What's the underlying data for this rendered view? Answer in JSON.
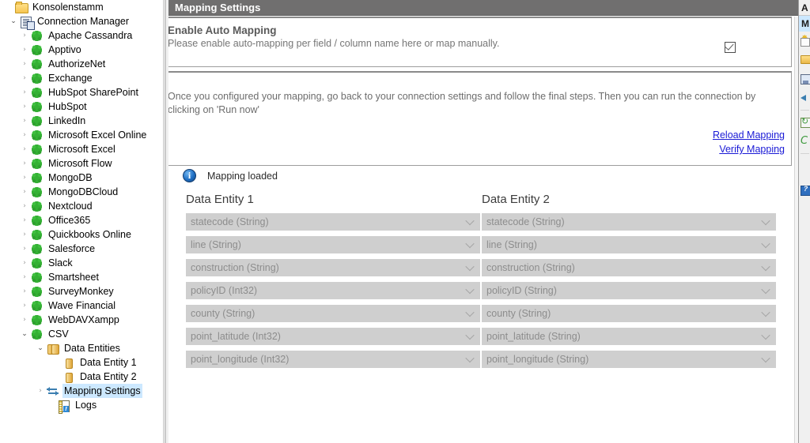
{
  "tree": {
    "root_label": "Konsolenstamm",
    "connection_manager_label": "Connection Manager",
    "connectors": [
      "Apache Cassandra",
      "Apptivo",
      "AuthorizeNet",
      "Exchange",
      "HubSpot SharePoint",
      "HubSpot",
      "LinkedIn",
      "Microsoft Excel Online",
      "Microsoft Excel",
      "Microsoft Flow",
      "MongoDB",
      "MongoDBCloud",
      "Nextcloud",
      "Office365",
      "Quickbooks Online",
      "Salesforce",
      "Slack",
      "Smartsheet",
      "SurveyMonkey",
      "Wave Financial",
      "WebDAVXampp"
    ],
    "csv_label": "CSV",
    "data_entities_label": "Data Entities",
    "data_entity_1_label": "Data Entity 1",
    "data_entity_2_label": "Data Entity 2",
    "mapping_settings_label": "Mapping Settings",
    "logs_label": "Logs",
    "selected_item": "Mapping Settings",
    "selection_color": "#cce8ff",
    "connector_icon_color": "#34b134"
  },
  "panel": {
    "header_title": "Mapping Settings",
    "header_bg": "#706f6f",
    "auto_mapping": {
      "title": "Enable Auto Mapping",
      "description": "Please enable auto-mapping per field / column name here or map manually.",
      "checkbox_checked": true,
      "checkbox_label": ""
    },
    "instructions": "Once you configured your mapping, go back to your connection settings and follow the final steps. Then you can run the connection by clicking on 'Run now'",
    "links": [
      {
        "label": "Reload Mapping"
      },
      {
        "label": "Verify Mapping"
      }
    ],
    "link_color": "#1a1ad6",
    "status": {
      "icon": "info-icon",
      "text": "Mapping loaded"
    },
    "entity_1": {
      "title": "Data Entity 1",
      "fields": [
        "statecode (String)",
        "line (String)",
        "construction (String)",
        "policyID (Int32)",
        "county (String)",
        "point_latitude (Int32)",
        "point_longitude (Int32)"
      ]
    },
    "entity_2": {
      "title": "Data Entity 2",
      "fields": [
        "statecode (String)",
        "line (String)",
        "construction (String)",
        "policyID (String)",
        "county (String)",
        "point_latitude (String)",
        "point_longitude (String)"
      ]
    }
  },
  "tool_strip": {
    "header_letter": "A",
    "selected_letter": "M",
    "items": [
      {
        "icon": "new-star-icon"
      },
      {
        "icon": "open-folder-icon"
      },
      {
        "icon": "save-icon"
      },
      {
        "icon": "back-arrow-icon"
      },
      {
        "icon": "refresh-icon"
      },
      {
        "icon": "connect-icon"
      },
      {
        "icon": "help-icon"
      }
    ]
  }
}
